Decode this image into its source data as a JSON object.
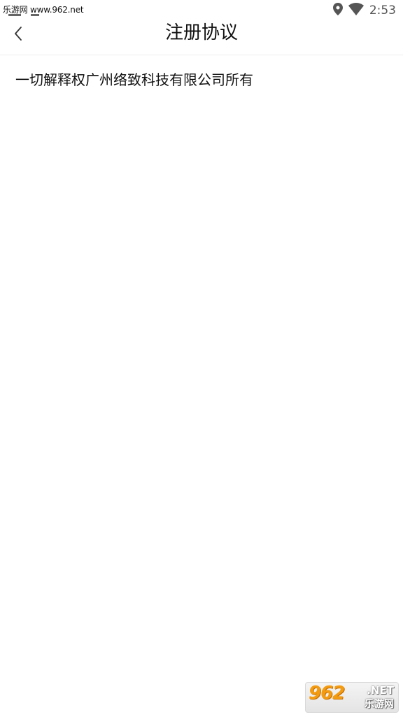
{
  "status_bar": {
    "watermark": "乐游网 www.962.net",
    "time": "2:53",
    "icons": [
      "location-icon",
      "wifi-icon"
    ]
  },
  "header": {
    "back_icon": "chevron-left-icon",
    "title": "注册协议"
  },
  "content": {
    "text": "一切解释权广州络致科技有限公司所有"
  },
  "corner_logo": {
    "number": "962",
    "suffix": ".NET",
    "name": "乐游网"
  },
  "colors": {
    "background": "#ffffff",
    "text": "#111111",
    "divider": "#eeeeee",
    "status_icons": "#555555",
    "logo_accent": "#f39c12"
  }
}
